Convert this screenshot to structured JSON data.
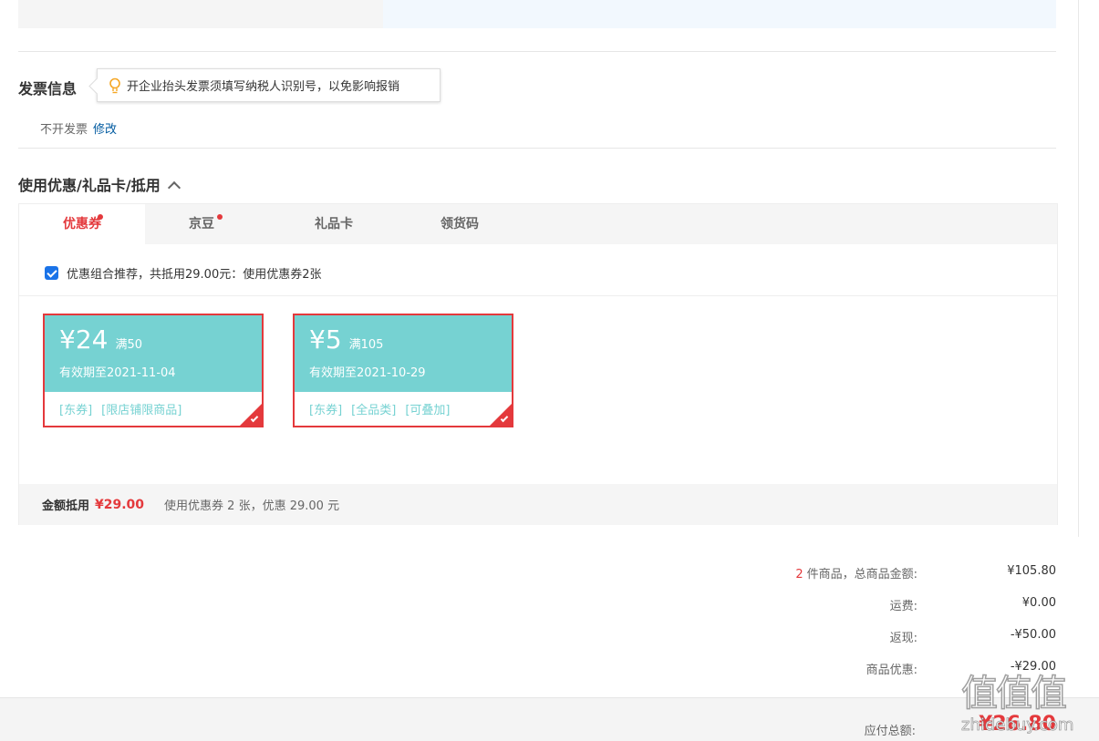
{
  "invoice": {
    "title": "发票信息",
    "tip": "开企业抬头发票须填写纳税人识别号，以免影响报销",
    "status": "不开发票",
    "edit_link": "修改"
  },
  "discount": {
    "title": "使用优惠/礼品卡/抵用",
    "tabs": [
      {
        "label": "优惠券",
        "dot": true,
        "active": true
      },
      {
        "label": "京豆",
        "dot": true,
        "active": false
      },
      {
        "label": "礼品卡",
        "dot": false,
        "active": false
      },
      {
        "label": "领货码",
        "dot": false,
        "active": false
      }
    ],
    "combo_text": "优惠组合推荐，共抵用29.00元：使用优惠券2张",
    "combo_checked": true,
    "coupons": [
      {
        "amount": "¥24",
        "condition": "满50",
        "validity": "有效期至2021-11-04",
        "tags": [
          "[东券]",
          "[限店铺限商品]"
        ],
        "selected": true
      },
      {
        "amount": "¥5",
        "condition": "满105",
        "validity": "有效期至2021-10-29",
        "tags": [
          "[东券]",
          "[全品类]",
          "[可叠加]"
        ],
        "selected": true
      }
    ],
    "summary_label": "金额抵用",
    "summary_amount": "¥29.00",
    "summary_desc": "使用优惠券 2 张，优惠 29.00 元"
  },
  "totals": {
    "item_count": "2",
    "goods_label": "件商品，总商品金额:",
    "goods_value": "¥105.80",
    "shipping_label": "运费:",
    "shipping_value": "¥0.00",
    "cashback_label": "返现:",
    "cashback_value": "-¥50.00",
    "discount_label": "商品优惠:",
    "discount_value": "-¥29.00",
    "payable_label": "应付总额:",
    "payable_value": "¥26.80"
  },
  "watermark": {
    "glyphs": "值值值",
    "site": "zhidebuy.com"
  },
  "colors": {
    "accent_red": "#e4393c",
    "coupon_teal": "#76d2d2",
    "link_blue": "#005aa0",
    "tip_bulb": "#f5a623"
  }
}
